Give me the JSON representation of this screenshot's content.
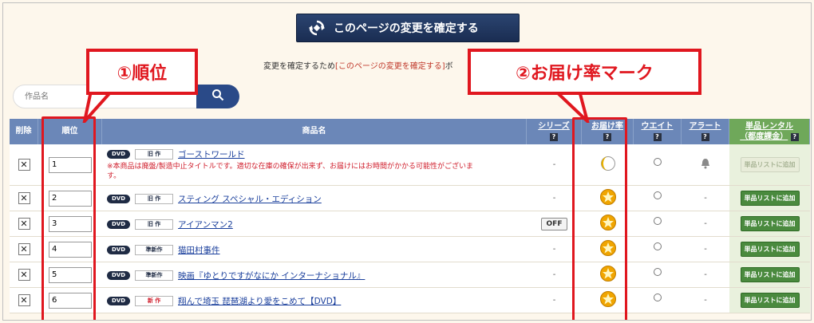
{
  "confirm_button": {
    "label": "このページの変更を確定する"
  },
  "note": {
    "prefix": "変更を確定するため",
    "link": "[このページの変更を確定する]",
    "suffix": "ボ"
  },
  "search": {
    "placeholder": "作品名"
  },
  "headers": {
    "delete": "削除",
    "rank": "順位",
    "product": "商品名",
    "series": "シリーズ",
    "delivery_rate": "お届け率",
    "wait": "ウエイト",
    "alert": "アラート",
    "single_rental_1": "単品レンタル",
    "single_rental_2": "（都度課金）",
    "help": "?"
  },
  "rows": [
    {
      "rank": "1",
      "format": "DVD",
      "type": "旧 作",
      "title": "ゴーストワールド",
      "note": "※本商品は廃盤/製造中止タイトルです。適切な在庫の確保が出来ず、お届けにはお時間がかかる可能性がございます。",
      "series": "-",
      "delivery": "half-moon-icon",
      "alert": "bell-icon",
      "single": "単品リストに追加",
      "single_disabled": true
    },
    {
      "rank": "2",
      "format": "DVD",
      "type": "旧 作",
      "title": "スティング スペシャル・エディション",
      "series": "-",
      "delivery": "star-icon",
      "alert": "-",
      "single": "単品リストに追加",
      "single_disabled": false
    },
    {
      "rank": "3",
      "format": "DVD",
      "type": "旧 作",
      "title": "アイアンマン2",
      "series": "OFF",
      "delivery": "star-icon",
      "alert": "-",
      "single": "単品リストに追加",
      "single_disabled": false
    },
    {
      "rank": "4",
      "format": "DVD",
      "type": "準新作",
      "title": "猫田村事件",
      "series": "-",
      "delivery": "star-icon",
      "alert": "-",
      "single": "単品リストに追加",
      "single_disabled": false
    },
    {
      "rank": "5",
      "format": "DVD",
      "type": "準新作",
      "title": "映画『ゆとりですがなにか インターナショナル』",
      "series": "-",
      "delivery": "star-icon",
      "alert": "-",
      "single": "単品リストに追加",
      "single_disabled": false
    },
    {
      "rank": "6",
      "format": "DVD",
      "type": "新 作",
      "title": "翔んで埼玉 琵琶湖より愛をこめて【DVD】",
      "series": "-",
      "delivery": "star-icon",
      "alert": "-",
      "single": "単品リストに追加",
      "single_disabled": false
    }
  ],
  "callouts": {
    "rank": "①順位",
    "delivery": "②お届け率マーク"
  },
  "colors": {
    "highlight": "#e0171f",
    "header": "#6b87b8",
    "green": "#4a8a3e",
    "navy": "#1f2b44"
  }
}
